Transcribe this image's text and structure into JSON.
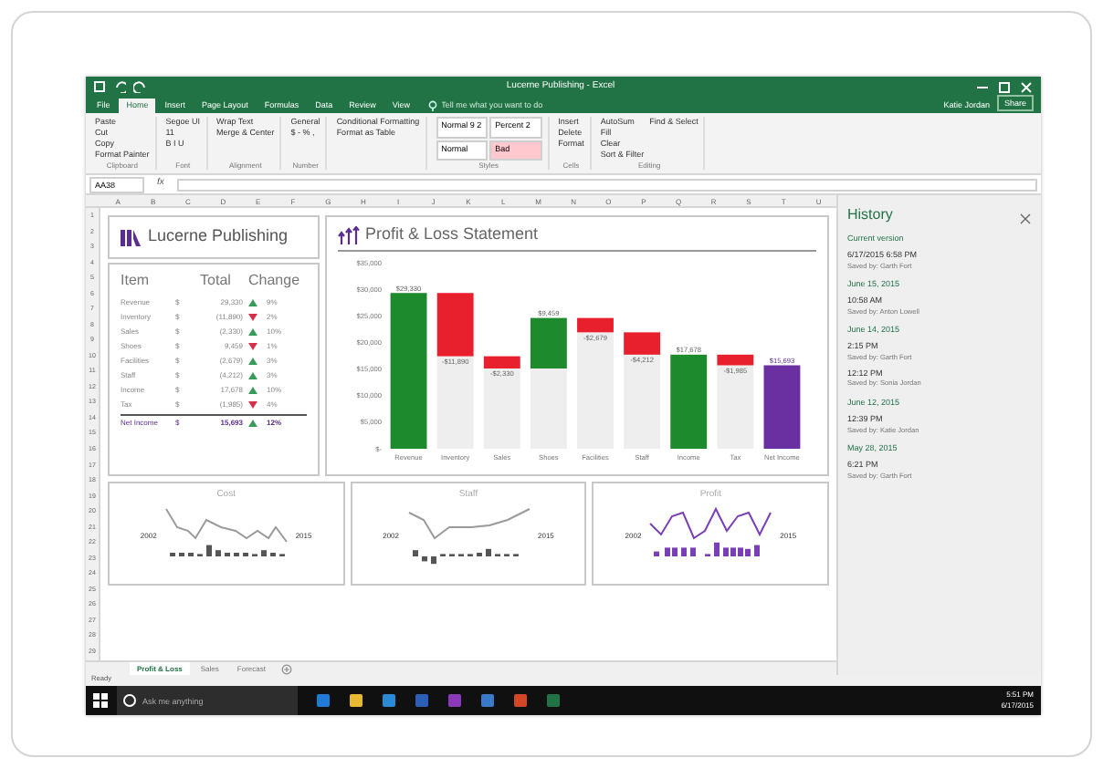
{
  "window": {
    "title": "Lucerne Publishing - Excel",
    "user": "Katie Jordan",
    "share": "Share"
  },
  "ribbon_tabs": [
    {
      "label": "File",
      "selected": false
    },
    {
      "label": "Home",
      "selected": true
    },
    {
      "label": "Insert",
      "selected": false
    },
    {
      "label": "Page Layout",
      "selected": false
    },
    {
      "label": "Formulas",
      "selected": false
    },
    {
      "label": "Data",
      "selected": false
    },
    {
      "label": "Review",
      "selected": false
    },
    {
      "label": "View",
      "selected": false
    }
  ],
  "tell_me": {
    "placeholder": "Tell me what you want to do"
  },
  "ribbon_groups": [
    {
      "kind": "list",
      "name": "Clipboard",
      "items": [
        "Paste",
        "Cut",
        "Copy",
        "Format Painter"
      ]
    },
    {
      "kind": "list",
      "name": "Font",
      "items": [
        "Segoe UI",
        "11",
        "B I U"
      ]
    },
    {
      "kind": "list",
      "name": "Alignment",
      "items": [
        "Wrap Text",
        "Merge & Center"
      ]
    },
    {
      "kind": "list",
      "name": "Number",
      "items": [
        "General",
        "$ - % ,"
      ]
    },
    {
      "kind": "list",
      "items": [
        "Conditional Formatting",
        "Format as Table"
      ]
    },
    {
      "kind": "styles",
      "name": "Styles",
      "items": [
        {
          "label": "Normal 9 2",
          "color": "#ffffff"
        },
        {
          "label": "Percent 2",
          "color": "#ffffff"
        },
        {
          "label": "Normal",
          "color": "#ffffff"
        },
        {
          "label": "Bad",
          "color": "#ffc7ce"
        }
      ]
    },
    {
      "kind": "list",
      "name": "Cells",
      "items": [
        "Insert",
        "Delete",
        "Format"
      ]
    },
    {
      "kind": "list",
      "name": "Editing",
      "items": [
        "AutoSum",
        "Fill",
        "Clear",
        "Sort & Filter",
        "Find & Select"
      ]
    }
  ],
  "formula_bar": {
    "name_box": "AA38",
    "fx": "fx"
  },
  "column_headers": [
    "A",
    "B",
    "C",
    "D",
    "E",
    "F",
    "G",
    "H",
    "I",
    "J",
    "K",
    "L",
    "M",
    "N",
    "O",
    "P",
    "Q",
    "R",
    "S",
    "T",
    "U"
  ],
  "row_headers": [
    "1",
    "2",
    "3",
    "4",
    "5",
    "6",
    "7",
    "8",
    "9",
    "10",
    "11",
    "12",
    "13",
    "14",
    "15",
    "16",
    "17",
    "18",
    "19",
    "20",
    "21",
    "22",
    "23",
    "24",
    "25",
    "26",
    "27",
    "28",
    "29"
  ],
  "logo": {
    "text": "Lucerne Publishing"
  },
  "summary_table": {
    "columns": [
      "Item",
      "Total",
      "Change"
    ],
    "rows": [
      {
        "item": "Revenue",
        "currency": "$",
        "total": "29,330",
        "rising": true,
        "change": "9%"
      },
      {
        "item": "Inventory",
        "currency": "$",
        "total": "(11,890)",
        "rising": false,
        "change": "2%"
      },
      {
        "item": "Sales",
        "currency": "$",
        "total": "(2,330)",
        "rising": true,
        "change": "10%"
      },
      {
        "item": "Shoes",
        "currency": "$",
        "total": "9,459",
        "rising": false,
        "change": "1%"
      },
      {
        "item": "Facilities",
        "currency": "$",
        "total": "(2,679)",
        "rising": true,
        "change": "3%"
      },
      {
        "item": "Staff",
        "currency": "$",
        "total": "(4,212)",
        "rising": true,
        "change": "3%"
      },
      {
        "item": "Income",
        "currency": "$",
        "total": "17,678",
        "rising": true,
        "change": "10%"
      },
      {
        "item": "Tax",
        "currency": "$",
        "total": "(1,985)",
        "rising": false,
        "change": "4%"
      }
    ],
    "total_row": {
      "item": "Net Income",
      "currency": "$",
      "total": "15,693",
      "rising": true,
      "change": "12%"
    }
  },
  "pl_chart": {
    "title": "Profit & Loss Statement",
    "chart_data": {
      "type": "bar",
      "categories": [
        "Revenue",
        "Inventory",
        "Sales",
        "Shoes",
        "Facilities",
        "Staff",
        "Income",
        "Tax",
        "Net Income"
      ],
      "stacked": true,
      "series": [
        {
          "color": "#eeeeee",
          "values": [
            0,
            17400,
            15100,
            15100,
            21900,
            17700,
            0,
            15700,
            0
          ]
        },
        {
          "color": "#1e8a2e",
          "values": [
            29300,
            null,
            null,
            9500,
            null,
            null,
            17700,
            null,
            null
          ]
        },
        {
          "color": "#e8202e",
          "values": [
            null,
            11900,
            2300,
            null,
            2700,
            4200,
            null,
            2000,
            null
          ]
        },
        {
          "color": "#6a2fa0",
          "values": [
            null,
            null,
            null,
            null,
            null,
            null,
            null,
            null,
            15700
          ]
        }
      ],
      "ylim": [
        0,
        35000
      ],
      "yticks": [
        {
          "value": 0,
          "label": "$-"
        },
        {
          "value": 5000,
          "label": "$5,000"
        },
        {
          "value": 10000,
          "label": "$10,000"
        },
        {
          "value": 15000,
          "label": "$15,000"
        },
        {
          "value": 20000,
          "label": "$20,000"
        },
        {
          "value": 25000,
          "label": "$25,000"
        },
        {
          "value": 30000,
          "label": "$30,000"
        },
        {
          "value": 35000,
          "label": "$35,000"
        }
      ],
      "value_labels": [
        "$29,330",
        "-$11,890",
        "-$2,330",
        "$9,459",
        "-$2,679",
        "-$4,212",
        "$17,678",
        "-$1,985",
        "$15,693"
      ]
    }
  },
  "sparkline_cards": [
    {
      "title": "Cost",
      "start": "2002",
      "end": "2015",
      "color": "#9a9a9a"
    },
    {
      "title": "Staff",
      "start": "2002",
      "end": "2015",
      "color": "#9a9a9a"
    },
    {
      "title": "Profit",
      "start": "2002",
      "end": "2015",
      "color": "#7a3fb5"
    }
  ],
  "sheet_tabs": [
    {
      "label": "Profit & Loss",
      "selected": true
    },
    {
      "label": "Sales",
      "selected": false
    },
    {
      "label": "Forecast",
      "selected": false
    }
  ],
  "status_bar": {
    "text": "Ready"
  },
  "history": {
    "title": "History",
    "groups": [
      {
        "heading": "Current version",
        "versions": [
          {
            "time": "6/17/2015 6:58 PM",
            "author": "Saved by: Garth Fort"
          }
        ]
      },
      {
        "heading": "June 15, 2015",
        "versions": [
          {
            "time": "10:58 AM",
            "author": "Saved by: Anton Lowell"
          }
        ]
      },
      {
        "heading": "June 14, 2015",
        "versions": [
          {
            "time": "2:15 PM",
            "author": "Saved by: Garth Fort"
          },
          {
            "time": "12:12 PM",
            "author": "Saved by: Sonia Jordan"
          }
        ]
      },
      {
        "heading": "June 12, 2015",
        "versions": [
          {
            "time": "12:39 PM",
            "author": "Saved by: Katie Jordan"
          }
        ]
      },
      {
        "heading": "May 28, 2015",
        "versions": [
          {
            "time": "6:21 PM",
            "author": "Saved by: Garth Fort"
          }
        ]
      }
    ]
  },
  "taskbar": {
    "search": {
      "placeholder": "Ask me anything"
    },
    "time": "5:51 PM",
    "date": "6/17/2015"
  }
}
